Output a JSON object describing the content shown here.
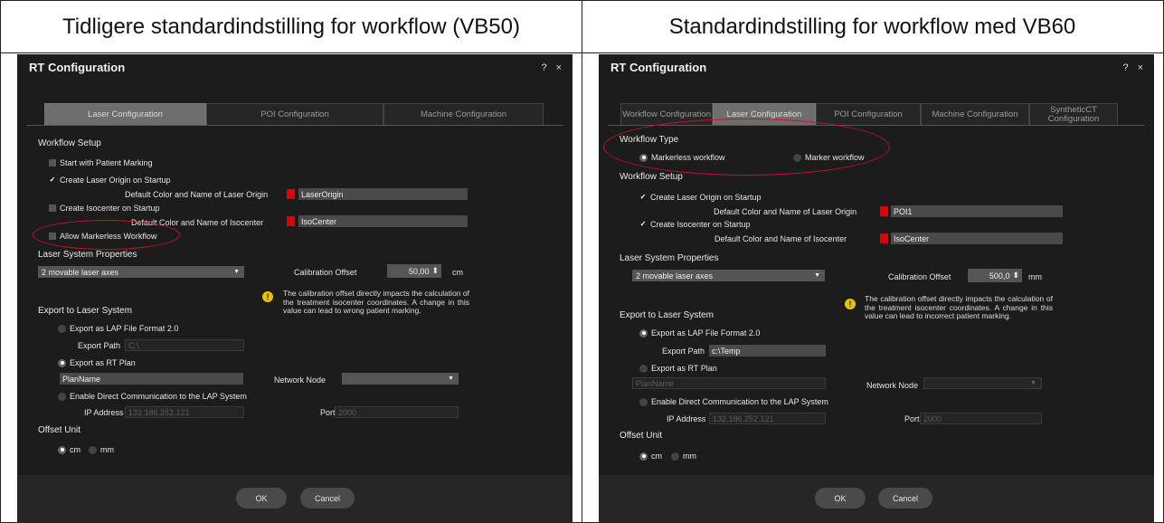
{
  "headers": {
    "left": "Tidligere standardindstilling for workflow (VB50)",
    "right": "Standardindstilling for workflow med VB60"
  },
  "left": {
    "title": "RT Configuration",
    "help": "?",
    "close": "×",
    "tabs": [
      "Laser Configuration",
      "POI Configuration",
      "Machine Configuration"
    ],
    "active_tab": 0,
    "workflow_setup": "Workflow Setup",
    "start_patient_marking": "Start with Patient Marking",
    "create_laser_origin": "Create Laser Origin on Startup",
    "laser_origin_label": "Default Color and Name of Laser Origin",
    "laser_origin_value": "LaserOrigin",
    "create_isocenter": "Create Isocenter on Startup",
    "isocenter_label": "Default Color and Name of Isocenter",
    "isocenter_value": "IsoCenter",
    "allow_markerless": "Allow Markerless Workflow",
    "laser_system_properties": "Laser System Properties",
    "laser_axes": "2 movable laser axes",
    "calibration_offset_label": "Calibration Offset",
    "calibration_offset_value": "50,00",
    "calibration_unit": "cm",
    "warning_text": "The calibration offset directly impacts the calculation of the treatment isocenter coordinates. A change in this value can lead to wrong patient marking.",
    "export_to_laser": "Export to Laser System",
    "export_lap": "Export as LAP File Format 2.0",
    "export_path_label": "Export Path",
    "export_path_value": "C:\\",
    "export_rt_plan": "Export as RT Plan",
    "plan_name": "PlanName",
    "network_node_label": "Network Node",
    "direct_comm": "Enable Direct Communication to the LAP System",
    "ip_label": "IP Address",
    "ip_value": "132.186.252.121",
    "port_label": "Port",
    "port_value": "2000",
    "offset_unit": "Offset Unit",
    "unit_cm": "cm",
    "unit_mm": "mm",
    "ok": "OK",
    "cancel": "Cancel"
  },
  "right": {
    "title": "RT Configuration",
    "help": "?",
    "close": "×",
    "tabs": [
      "Workflow Configuration",
      "Laser Configuration",
      "POI Configuration",
      "Machine Configuration",
      "SyntheticCT Configuration"
    ],
    "active_tab": 1,
    "workflow_type": "Workflow Type",
    "markerless_workflow": "Markerless workflow",
    "marker_workflow": "Marker workflow",
    "workflow_setup": "Workflow Setup",
    "create_laser_origin": "Create Laser Origin on Startup",
    "laser_origin_label": "Default Color and Name of Laser Origin",
    "laser_origin_value": "POI1",
    "create_isocenter": "Create Isocenter on Startup",
    "isocenter_label": "Default Color and Name of Isocenter",
    "isocenter_value": "IsoCenter",
    "laser_system_properties": "Laser System Properties",
    "laser_axes": "2 movable laser axes",
    "calibration_offset_label": "Calibration Offset",
    "calibration_offset_value": "500,0",
    "calibration_unit": "mm",
    "warning_text": "The calibration offset directly impacts the calculation of the treatment isocenter coordinates. A change in this value can lead to incorrect patient marking.",
    "export_to_laser": "Export to Laser System",
    "export_lap": "Export as LAP File Format 2.0",
    "export_path_label": "Export Path",
    "export_path_value": "c:\\Temp",
    "export_rt_plan": "Export as RT Plan",
    "plan_name": "PlanName",
    "network_node_label": "Network Node",
    "direct_comm": "Enable Direct Communication to the LAP System",
    "ip_label": "IP Address",
    "ip_value": "132.186.252.121",
    "port_label": "Port",
    "port_value": "2000",
    "offset_unit": "Offset Unit",
    "unit_cm": "cm",
    "unit_mm": "mm",
    "ok": "OK",
    "cancel": "Cancel"
  },
  "colors": {
    "highlight_ellipse": "#c8102e",
    "swatch": "#e00000",
    "dialog_bg": "#1c1c1c"
  }
}
